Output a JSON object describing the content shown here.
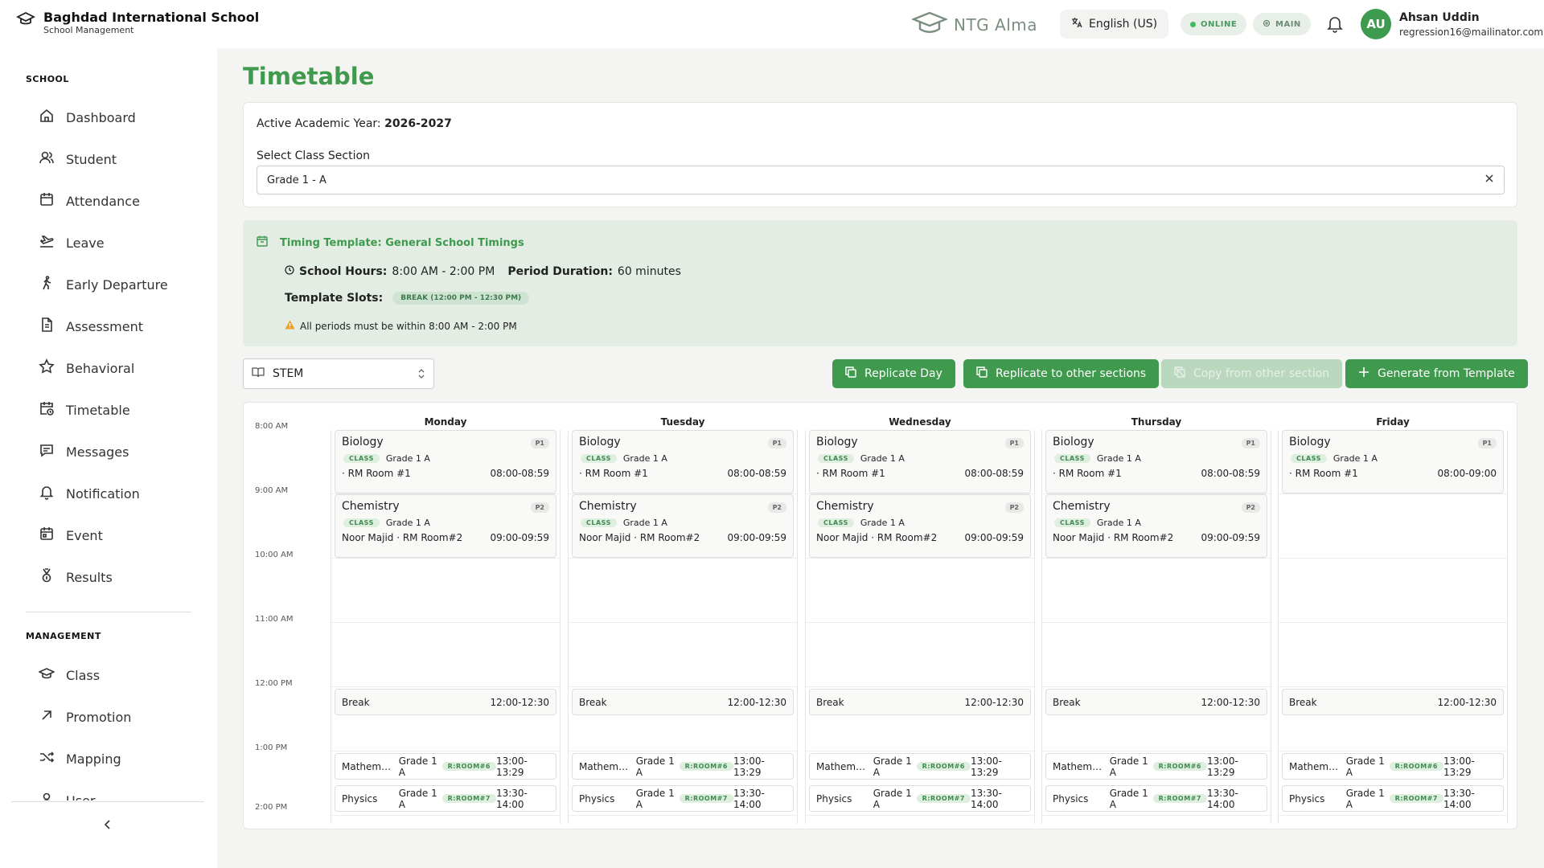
{
  "header": {
    "school_name": "Baghdad International School",
    "school_sub": "School Management",
    "product": "NTG Alma",
    "language": "English (US)",
    "status_online": "ONLINE",
    "status_main": "MAIN",
    "user_initials": "AU",
    "user_name": "Ahsan Uddin",
    "user_email": "regression16@mailinator.com"
  },
  "sidebar": {
    "school_title": "SCHOOL",
    "management_title": "MANAGEMENT",
    "school_items": [
      {
        "label": "Dashboard",
        "icon": "home-icon"
      },
      {
        "label": "Student",
        "icon": "users-icon"
      },
      {
        "label": "Attendance",
        "icon": "calendar-icon"
      },
      {
        "label": "Leave",
        "icon": "plane-icon"
      },
      {
        "label": "Early Departure",
        "icon": "walking-icon"
      },
      {
        "label": "Assessment",
        "icon": "document-icon"
      },
      {
        "label": "Behavioral",
        "icon": "star-icon"
      },
      {
        "label": "Timetable",
        "icon": "calendar-clock-icon"
      },
      {
        "label": "Messages",
        "icon": "message-icon"
      },
      {
        "label": "Notification",
        "icon": "bell-icon"
      },
      {
        "label": "Event",
        "icon": "calendar-event-icon"
      },
      {
        "label": "Results",
        "icon": "medal-icon"
      }
    ],
    "management_items": [
      {
        "label": "Class",
        "icon": "graduation-cap-icon"
      },
      {
        "label": "Promotion",
        "icon": "arrow-up-right-icon"
      },
      {
        "label": "Mapping",
        "icon": "shuffle-icon"
      },
      {
        "label": "User",
        "icon": "user-icon"
      }
    ]
  },
  "page": {
    "title": "Timetable",
    "academic_year_label": "Active Academic Year:",
    "academic_year_value": "2026-2027",
    "class_section_label": "Select Class Section",
    "class_section_value": "Grade 1 - A"
  },
  "template": {
    "title": "Timing Template: General School Timings",
    "school_hours_label": "School Hours:",
    "school_hours_value": "8:00 AM - 2:00 PM",
    "period_duration_label": "Period Duration:",
    "period_duration_value": "60 minutes",
    "slots_label": "Template Slots:",
    "break_chip": "BREAK (12:00 PM - 12:30 PM)",
    "warning": "All periods must be within 8:00 AM - 2:00 PM"
  },
  "toolbar": {
    "stream": "STEM",
    "replicate_day": "Replicate Day",
    "replicate_sections": "Replicate to other sections",
    "copy_section": "Copy from other section",
    "generate": "Generate from Template"
  },
  "timetable": {
    "times": [
      "8:00 AM",
      "9:00 AM",
      "10:00 AM",
      "11:00 AM",
      "12:00 PM",
      "1:00 PM",
      "2:00 PM"
    ],
    "class_tag": "CLASS",
    "days": [
      {
        "name": "Monday",
        "periods": [
          {
            "subject": "Biology",
            "badge": "P1",
            "class": "Grade 1 A",
            "room": "· RM Room #1",
            "time": "08:00-08:59"
          },
          {
            "subject": "Chemistry",
            "badge": "P2",
            "class": "Grade 1 A",
            "room": "Noor Majid · RM Room#2",
            "time": "09:00-09:59"
          }
        ],
        "break_label": "Break",
        "break_time": "12:00-12:30",
        "slots": [
          {
            "subject": "Mathema...",
            "class": "Grade 1 A",
            "room": "R:ROOM#6",
            "time": "13:00-13:29"
          },
          {
            "subject": "Physics",
            "class": "Grade 1 A",
            "room": "R:ROOM#7",
            "time": "13:30-14:00"
          }
        ]
      },
      {
        "name": "Tuesday",
        "periods": [
          {
            "subject": "Biology",
            "badge": "P1",
            "class": "Grade 1 A",
            "room": "· RM Room #1",
            "time": "08:00-08:59"
          },
          {
            "subject": "Chemistry",
            "badge": "P2",
            "class": "Grade 1 A",
            "room": "Noor Majid · RM Room#2",
            "time": "09:00-09:59"
          }
        ],
        "break_label": "Break",
        "break_time": "12:00-12:30",
        "slots": [
          {
            "subject": "Mathema...",
            "class": "Grade 1 A",
            "room": "R:ROOM#6",
            "time": "13:00-13:29"
          },
          {
            "subject": "Physics",
            "class": "Grade 1 A",
            "room": "R:ROOM#7",
            "time": "13:30-14:00"
          }
        ]
      },
      {
        "name": "Wednesday",
        "periods": [
          {
            "subject": "Biology",
            "badge": "P1",
            "class": "Grade 1 A",
            "room": "· RM Room #1",
            "time": "08:00-08:59"
          },
          {
            "subject": "Chemistry",
            "badge": "P2",
            "class": "Grade 1 A",
            "room": "Noor Majid · RM Room#2",
            "time": "09:00-09:59"
          }
        ],
        "break_label": "Break",
        "break_time": "12:00-12:30",
        "slots": [
          {
            "subject": "Mathema...",
            "class": "Grade 1 A",
            "room": "R:ROOM#6",
            "time": "13:00-13:29"
          },
          {
            "subject": "Physics",
            "class": "Grade 1 A",
            "room": "R:ROOM#7",
            "time": "13:30-14:00"
          }
        ]
      },
      {
        "name": "Thursday",
        "periods": [
          {
            "subject": "Biology",
            "badge": "P1",
            "class": "Grade 1 A",
            "room": "· RM Room #1",
            "time": "08:00-08:59"
          },
          {
            "subject": "Chemistry",
            "badge": "P2",
            "class": "Grade 1 A",
            "room": "Noor Majid · RM Room#2",
            "time": "09:00-09:59"
          }
        ],
        "break_label": "Break",
        "break_time": "12:00-12:30",
        "slots": [
          {
            "subject": "Mathema...",
            "class": "Grade 1 A",
            "room": "R:ROOM#6",
            "time": "13:00-13:29"
          },
          {
            "subject": "Physics",
            "class": "Grade 1 A",
            "room": "R:ROOM#7",
            "time": "13:30-14:00"
          }
        ]
      },
      {
        "name": "Friday",
        "periods": [
          {
            "subject": "Biology",
            "badge": "P1",
            "class": "Grade 1 A",
            "room": "· RM Room #1",
            "time": "08:00-09:00"
          }
        ],
        "break_label": "Break",
        "break_time": "12:00-12:30",
        "slots": [
          {
            "subject": "Mathema...",
            "class": "Grade 1 A",
            "room": "R:ROOM#6",
            "time": "13:00-13:29"
          },
          {
            "subject": "Physics",
            "class": "Grade 1 A",
            "room": "R:ROOM#7",
            "time": "13:30-14:00"
          }
        ]
      }
    ]
  },
  "colors": {
    "accent": "#3f9a4e",
    "template_bg": "#e3ede4",
    "disabled": "#b9d8be"
  }
}
